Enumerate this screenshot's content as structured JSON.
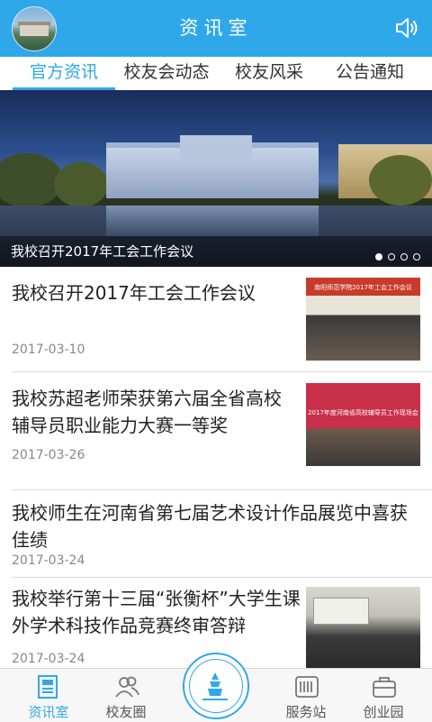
{
  "header": {
    "title": "资讯室"
  },
  "tabs": [
    {
      "label": "官方资讯",
      "active": true
    },
    {
      "label": "校友会动态",
      "active": false
    },
    {
      "label": "校友风采",
      "active": false
    },
    {
      "label": "公告通知",
      "active": false
    }
  ],
  "banner": {
    "caption": "我校召开2017年工会工作会议",
    "current_slide": 1,
    "total_slides": 4
  },
  "news": [
    {
      "title": "我校召开2017年工会工作会议",
      "date": "2017-03-10",
      "thumb_text": "南阳师范学院2017年工会工作会议"
    },
    {
      "title": "我校苏超老师荣获第六届全省高校辅导员职业能力大赛一等奖",
      "date": "2017-03-26",
      "thumb_text": "2017年度河南省高校辅导员工作现场会"
    },
    {
      "title": "我校师生在河南省第七届艺术设计作品展览中喜获佳绩",
      "date": "2017-03-24"
    },
    {
      "title": "我校举行第十三届“张衡杯”大学生课外学术科技作品竞赛终审答辩",
      "date": "2017-03-24"
    }
  ],
  "bottom_nav": [
    {
      "label": "资讯室",
      "icon": "newspaper-icon",
      "active": true
    },
    {
      "label": "校友圈",
      "icon": "people-icon",
      "active": false
    },
    {
      "label": "服务站",
      "icon": "service-icon",
      "active": false
    },
    {
      "label": "创业园",
      "icon": "briefcase-icon",
      "active": false
    }
  ],
  "colors": {
    "accent": "#2fa8ea",
    "text": "#222222",
    "date": "#888888"
  }
}
